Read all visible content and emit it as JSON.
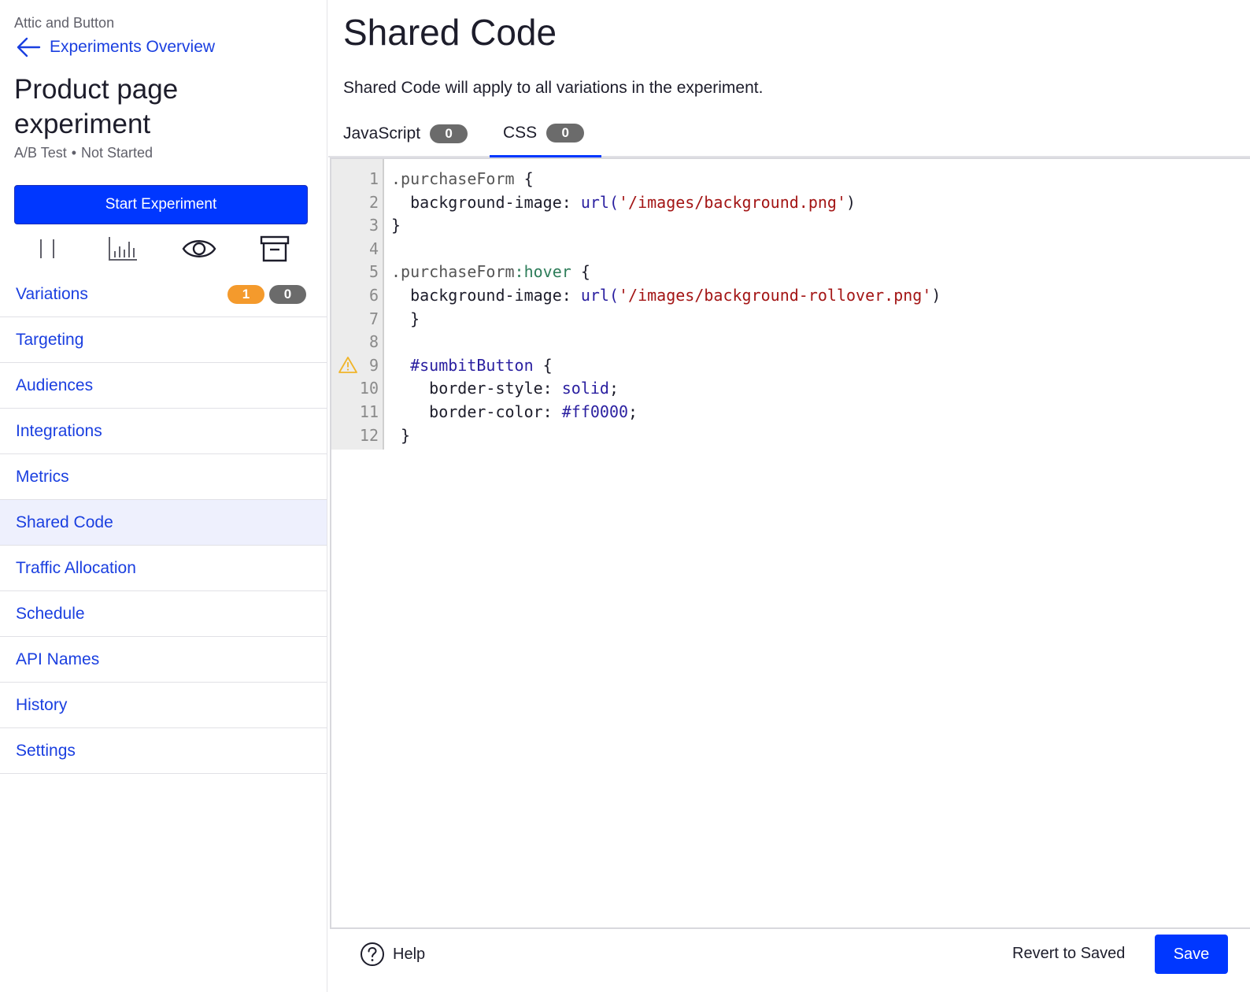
{
  "sidebar": {
    "project_name": "Attic and Button",
    "back_label": "Experiments Overview",
    "experiment_title": "Product page experiment",
    "experiment_type": "A/B Test",
    "experiment_status": "Not Started",
    "start_button": "Start Experiment",
    "action_icons": [
      "pause-icon",
      "results-chart-icon",
      "preview-eye-icon",
      "archive-icon"
    ],
    "nav": [
      {
        "label": "Variations",
        "badges": [
          {
            "value": "1",
            "color": "#f49a2c"
          },
          {
            "value": "0",
            "color": "#6b6b6b"
          }
        ]
      },
      {
        "label": "Targeting"
      },
      {
        "label": "Audiences"
      },
      {
        "label": "Integrations"
      },
      {
        "label": "Metrics"
      },
      {
        "label": "Shared Code",
        "active": true
      },
      {
        "label": "Traffic Allocation"
      },
      {
        "label": "Schedule"
      },
      {
        "label": "API Names"
      },
      {
        "label": "History"
      },
      {
        "label": "Settings"
      }
    ]
  },
  "main": {
    "title": "Shared Code",
    "description": "Shared Code will apply to all variations in the experiment.",
    "tabs": [
      {
        "label": "JavaScript",
        "count": "0"
      },
      {
        "label": "CSS",
        "count": "0",
        "active": true
      }
    ],
    "code_lines": [
      [
        {
          "t": ".purchaseForm",
          "c": "sel"
        },
        {
          "t": " {"
        }
      ],
      [
        {
          "t": "  background-image: "
        },
        {
          "t": "url(",
          "c": "fn"
        },
        {
          "t": "'/images/background.png'",
          "c": "str"
        },
        {
          "t": ")"
        }
      ],
      [
        {
          "t": "}"
        }
      ],
      [
        {
          "t": ""
        }
      ],
      [
        {
          "t": ".purchaseForm",
          "c": "sel"
        },
        {
          "t": ":hover",
          "c": "pseudo"
        },
        {
          "t": " {"
        }
      ],
      [
        {
          "t": "  background-image: "
        },
        {
          "t": "url(",
          "c": "fn"
        },
        {
          "t": "'/images/background-rollover.png'",
          "c": "str"
        },
        {
          "t": ")"
        }
      ],
      [
        {
          "t": "  }"
        }
      ],
      [
        {
          "t": ""
        }
      ],
      [
        {
          "t": "  "
        },
        {
          "t": "#sumbitButton",
          "c": "id"
        },
        {
          "t": " {"
        }
      ],
      [
        {
          "t": "    border-style: "
        },
        {
          "t": "solid",
          "c": "val"
        },
        {
          "t": ";"
        }
      ],
      [
        {
          "t": "    border-color: "
        },
        {
          "t": "#ff0000",
          "c": "val"
        },
        {
          "t": ";"
        }
      ],
      [
        {
          "t": " }"
        }
      ]
    ],
    "warning_line": 9,
    "warning_color": "#f0b429"
  },
  "footer": {
    "help_label": "Help",
    "revert_label": "Revert to Saved",
    "save_label": "Save"
  },
  "colors": {
    "accent": "#0037ff",
    "link": "#1a3fe0",
    "active_nav_bg": "#eef0fd"
  }
}
